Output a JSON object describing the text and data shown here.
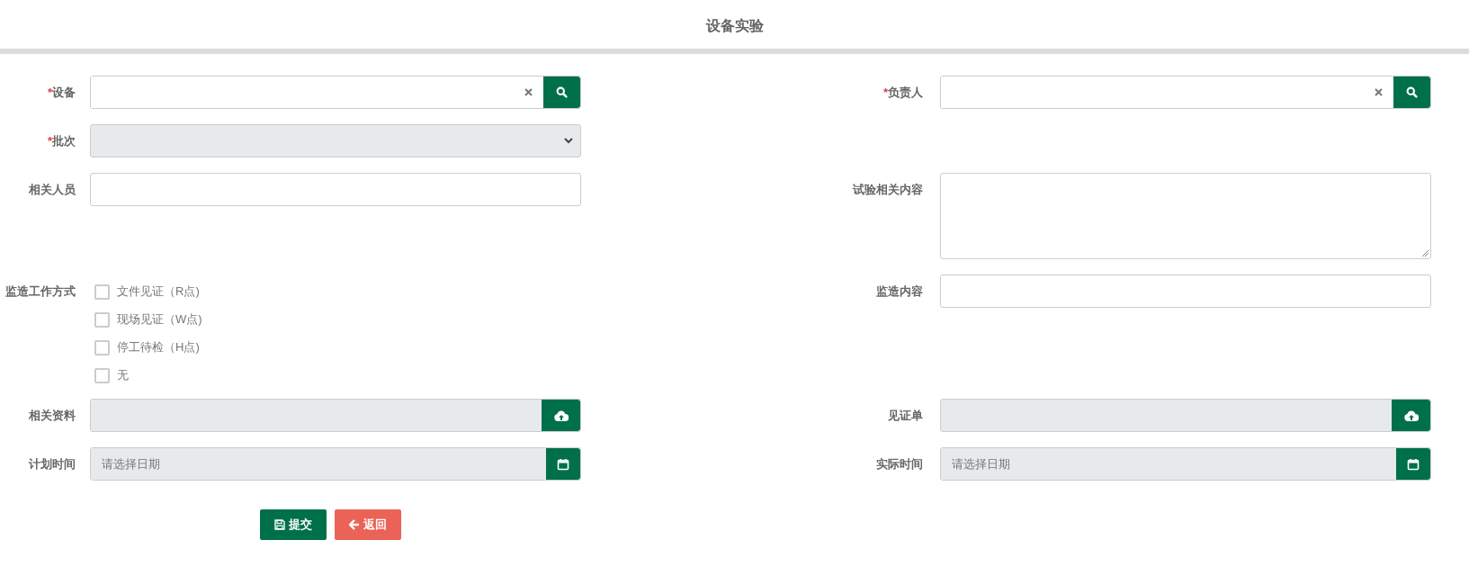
{
  "page": {
    "title": "设备实验"
  },
  "rows": [
    {
      "left": {
        "kind": "search",
        "required_mark": "*",
        "label": "设备"
      },
      "right": {
        "kind": "search",
        "required_mark": "*",
        "label": "负责人"
      }
    },
    {
      "left": {
        "kind": "select",
        "required_mark": "*",
        "label": "批次"
      }
    },
    {
      "left": {
        "kind": "text",
        "label": "相关人员"
      },
      "right": {
        "kind": "textarea",
        "label": "试验相关内容"
      }
    },
    {
      "left": {
        "kind": "checkboxes",
        "label": "监造工作方式",
        "options": [
          {
            "label": "文件见证（R点)",
            "checked": false
          },
          {
            "label": "现场见证（W点)",
            "checked": false
          },
          {
            "label": "停工待检（H点)",
            "checked": false
          },
          {
            "label": "无",
            "checked": false
          }
        ]
      },
      "right": {
        "kind": "text",
        "label": "监造内容"
      }
    },
    {
      "left": {
        "kind": "upload",
        "label": "相关资料"
      },
      "right": {
        "kind": "upload",
        "label": "见证单"
      }
    },
    {
      "left": {
        "kind": "date",
        "label": "计划时间",
        "placeholder": "请选择日期"
      },
      "right": {
        "kind": "date",
        "label": "实际时间",
        "placeholder": "请选择日期"
      }
    }
  ],
  "buttons": [
    {
      "kind": "submit",
      "label": "提交"
    },
    {
      "kind": "back",
      "label": "返回"
    }
  ]
}
